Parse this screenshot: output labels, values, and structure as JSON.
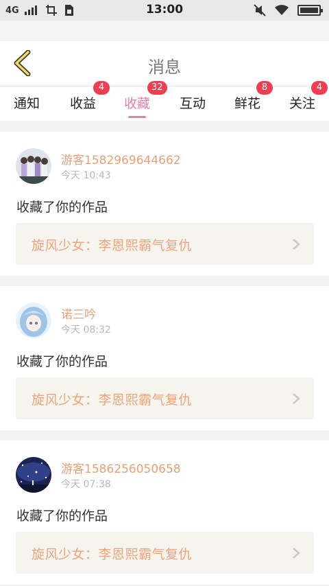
{
  "status_bar": {
    "network": "4G",
    "time": "13:00"
  },
  "header": {
    "title": "消息"
  },
  "tabs": [
    {
      "label": "通知",
      "badge": ""
    },
    {
      "label": "收益",
      "badge": "4"
    },
    {
      "label": "收藏",
      "badge": "32",
      "active": true
    },
    {
      "label": "互动",
      "badge": ""
    },
    {
      "label": "鲜花",
      "badge": "8"
    },
    {
      "label": "关注",
      "badge": "4"
    }
  ],
  "messages": [
    {
      "user": "游客1582969644662",
      "time": "今天 10:43",
      "action": "收藏了你的作品",
      "work": "旋风少女：李恩熙霸气复仇"
    },
    {
      "user": "诺三吟",
      "time": "今天 08:32",
      "action": "收藏了你的作品",
      "work": "旋风少女：李恩熙霸气复仇"
    },
    {
      "user": "游客1586256050658",
      "time": "今天 07:38",
      "action": "收藏了你的作品",
      "work": "旋风少女：李恩熙霸气复仇"
    }
  ],
  "colors": {
    "accent": "#e87ea9",
    "badge": "#ee3f52",
    "username": "#e89f74",
    "work_title": "#f0a37a"
  }
}
